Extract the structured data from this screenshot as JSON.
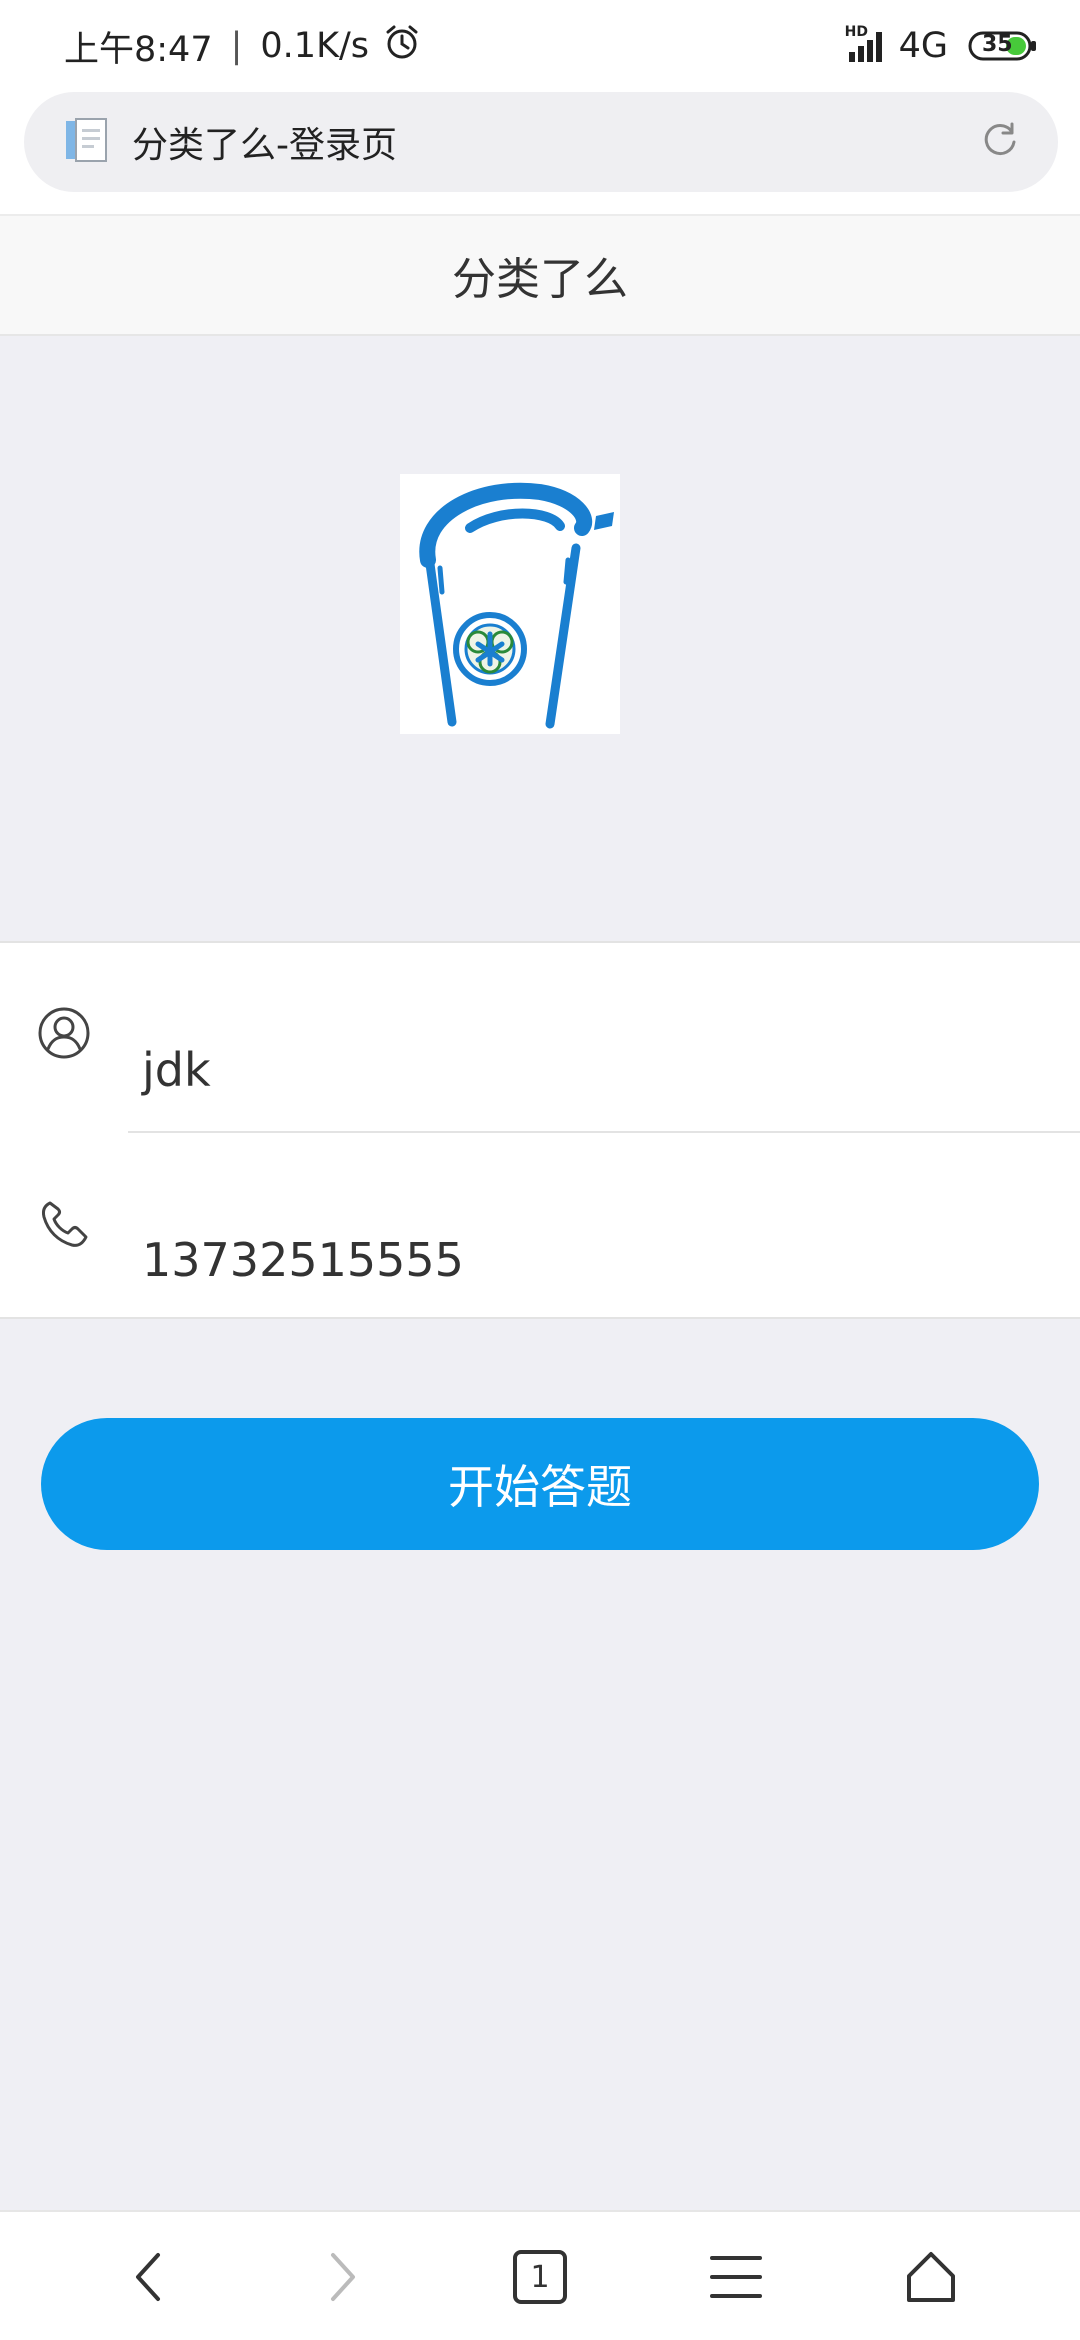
{
  "status_bar": {
    "time": "上午8:47",
    "separator": "|",
    "net_speed": "0.1K/s",
    "network": "4G",
    "hd_label": "HD",
    "battery": "35"
  },
  "browser": {
    "page_title": "分类了么-登录页"
  },
  "app": {
    "header_title": "分类了么"
  },
  "form": {
    "username": "jdk",
    "phone": "13732515555"
  },
  "actions": {
    "start_label": "开始答题"
  },
  "bottom_nav": {
    "tab_count": "1"
  },
  "colors": {
    "accent": "#0c9aec",
    "page_bg": "#efeff4",
    "logo_blue": "#1a7fd0"
  }
}
